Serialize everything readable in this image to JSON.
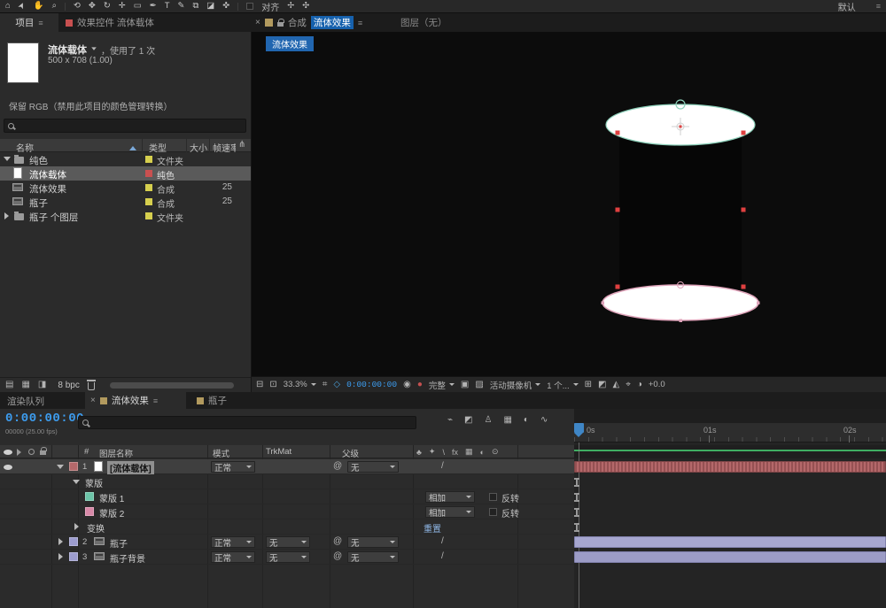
{
  "colors": {
    "accent_blue": "#1661ad",
    "time_blue": "#3d9df0",
    "mask1": "#8fd2bc",
    "mask2": "#dfa4ba",
    "handle_red": "#e04040",
    "layer_bar_red": "#b4686a",
    "layer_bar_lavender": "#a6a6cf",
    "work_line_green": "#3fae62",
    "label_yellow": "#d6cf4e",
    "label_red": "#c95050",
    "label_lavender": "#9c9cce",
    "comp_tab_tan": "#b29a5e"
  },
  "toolbar": {
    "tools": [
      {
        "name": "home",
        "glyph": "⌂"
      },
      {
        "name": "selection",
        "glyph": "➤"
      },
      {
        "name": "hand",
        "glyph": "✋"
      },
      {
        "name": "zoom",
        "glyph": "⌕"
      },
      {
        "name": "orbit-camera",
        "glyph": "⟲"
      },
      {
        "name": "pan-camera",
        "glyph": "✥"
      },
      {
        "name": "rotation",
        "glyph": "↻"
      },
      {
        "name": "pan-behind",
        "glyph": "✛"
      },
      {
        "name": "shape",
        "glyph": "▭"
      },
      {
        "name": "pen",
        "glyph": "✒"
      },
      {
        "name": "type",
        "glyph": "T"
      },
      {
        "name": "brush",
        "glyph": "✎"
      },
      {
        "name": "clone-stamp",
        "glyph": "⧉"
      },
      {
        "name": "eraser",
        "glyph": "◪"
      },
      {
        "name": "puppet",
        "glyph": "✜"
      }
    ],
    "align": "对齐",
    "extra1": "✢",
    "extra2": "✣",
    "workspace": "默认",
    "menu": "≡"
  },
  "project": {
    "tab_label": "项目",
    "tab_menu": "≡",
    "effects_tab_label": "效果控件 流体载体",
    "item_name": "流体载体",
    "item_usage": "，使用了 1 次",
    "item_dims": "500 x 708 (1.00)",
    "color_note": "保留 RGB（禁用此项目的颜色管理转换）",
    "columns": {
      "name": "名称",
      "type": "类型",
      "size": "大小",
      "rate": "帧速率"
    },
    "header_icon": "⋔",
    "rows": [
      {
        "name": "纯色",
        "type": "文件夹",
        "rate": ""
      },
      {
        "name": "流体载体",
        "type": "纯色",
        "rate": ""
      },
      {
        "name": "流体效果",
        "type": "合成",
        "rate": "25"
      },
      {
        "name": "瓶子",
        "type": "合成",
        "rate": "25"
      },
      {
        "name": "瓶子 个图层",
        "type": "文件夹",
        "rate": ""
      }
    ],
    "footer_icons": [
      "▤",
      "▦",
      "◨"
    ],
    "footer_bpc": "8 bpc"
  },
  "viewer": {
    "close": "×",
    "tab_prefix": "合成",
    "tab_comp": "流体效果",
    "tab_menu": "≡",
    "tab_layer": "图层（无）",
    "breadcrumb": "流体效果",
    "icons": {
      "monitor": "⊟",
      "split": "⊡",
      "grid": "⌗",
      "mask": "◇",
      "snapshot": "◉",
      "channels": "●",
      "roi": "▣",
      "checker": "▨",
      "layout": "⊞",
      "pixel": "◩",
      "preview": "◭",
      "flow": "⌖",
      "exposure": "◑"
    },
    "footer": {
      "zoom": "33.3%",
      "time": "0:00:00:00",
      "resolution": "完整",
      "camera": "活动摄像机",
      "views": "1 个...",
      "exposure": "+0.0"
    }
  },
  "timeline": {
    "tab_render_queue": "渲染队列",
    "tab_close": "×",
    "tab_comp": "流体效果",
    "tab_menu": "≡",
    "tab_comp2": "瓶子",
    "time": "0:00:00:00",
    "frame_info": "00000 (25.00 fps)",
    "panel_icons": [
      {
        "name": "composition-mini-flowchart-icon",
        "glyph": "⌁"
      },
      {
        "name": "draft-3d-icon",
        "glyph": "◩"
      },
      {
        "name": "shy-layers-icon",
        "glyph": "♙"
      },
      {
        "name": "frame-blending-icon",
        "glyph": "▦"
      },
      {
        "name": "motion-blur-icon",
        "glyph": "◐"
      },
      {
        "name": "graph-editor-icon",
        "glyph": "∿"
      }
    ],
    "columns": {
      "hash": "#",
      "layer_name": "图层名称",
      "mode": "模式",
      "trkmat": "TrkMat",
      "parent": "父级"
    },
    "switch_icons": [
      "♣",
      "✦",
      "\\",
      "fx",
      "▦",
      "◐",
      "⊙"
    ],
    "pickwhip": "@",
    "quality": "/",
    "layer1": {
      "num": "1",
      "name": "[流体载体]",
      "mode": "正常",
      "parent": "无"
    },
    "mask_group": "蒙版",
    "mask1": {
      "name": "蒙版 1",
      "mode": "相加",
      "invert": "反转"
    },
    "mask2": {
      "name": "蒙版 2",
      "mode": "相加",
      "invert": "反转"
    },
    "transform": "变换",
    "reset": "重置",
    "layer2": {
      "num": "2",
      "name": "瓶子",
      "mode": "正常",
      "trkmat": "无",
      "parent": "无"
    },
    "layer3": {
      "num": "3",
      "name": "瓶子背景",
      "mode": "正常",
      "trkmat": "无",
      "parent": "无"
    },
    "ruler": {
      "t0": "0s",
      "t1": "01s",
      "t2": "02s"
    }
  }
}
